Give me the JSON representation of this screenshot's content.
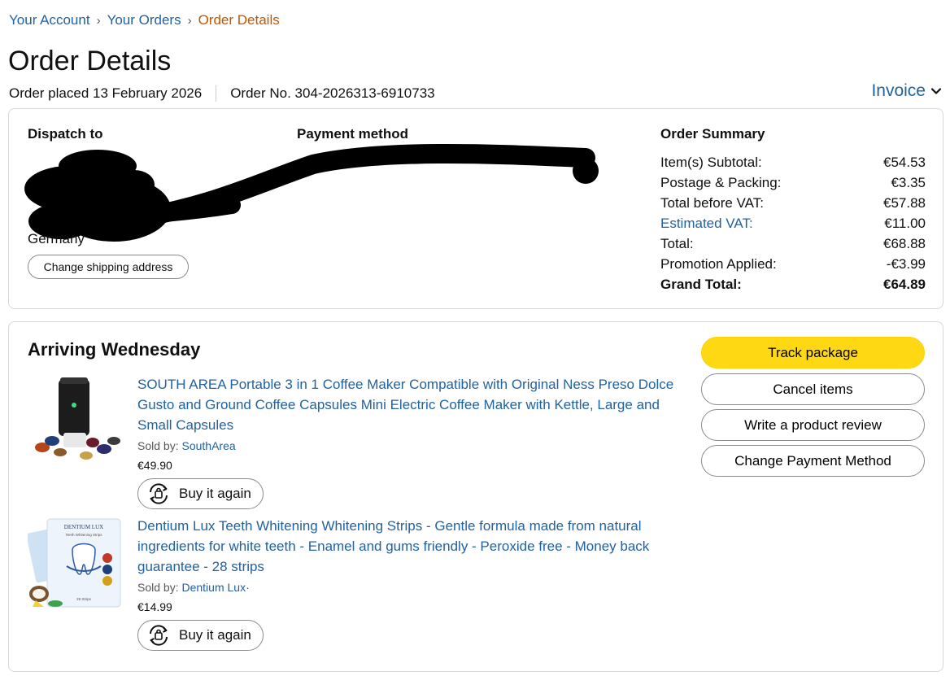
{
  "breadcrumb": {
    "items": [
      {
        "label": "Your Account"
      },
      {
        "label": "Your Orders"
      },
      {
        "label": "Order Details"
      }
    ],
    "separator": "›"
  },
  "header": {
    "title": "Order Details",
    "order_placed": "Order placed 13 February 2026",
    "order_number": "Order No. 304-2026313-6910733",
    "invoice_label": "Invoice"
  },
  "shipping": {
    "heading": "Dispatch to",
    "country": "Germany",
    "change_button": "Change shipping address"
  },
  "payment": {
    "heading": "Payment method"
  },
  "summary": {
    "heading": "Order Summary",
    "rows": [
      {
        "label": "Item(s) Subtotal:",
        "value": "€54.53"
      },
      {
        "label": "Postage & Packing:",
        "value": "€3.35"
      },
      {
        "label": "Total before VAT:",
        "value": "€57.88"
      },
      {
        "label": "Estimated VAT:",
        "value": "€11.00"
      },
      {
        "label": "Total:",
        "value": "€68.88"
      },
      {
        "label": "Promotion Applied:",
        "value": "-€3.99"
      },
      {
        "label": "Grand Total:",
        "value": "€64.89"
      }
    ]
  },
  "shipment": {
    "status": "Arriving Wednesday",
    "items": [
      {
        "title": "SOUTH AREA Portable 3 in 1 Coffee Maker Compatible with Original Ness Preso Dolce Gusto and Ground Coffee Capsules Mini Electric Coffee Maker with Kettle, Large and Small Capsules",
        "sold_by_label": "Sold by: ",
        "seller": "SouthArea",
        "price": "€49.90",
        "buy_again": "Buy it again"
      },
      {
        "title": "Dentium Lux Teeth Whitening Whitening Strips - Gentle formula made from natural ingredients for white teeth - Enamel and gums friendly - Peroxide free - Money back guarantee - 28 strips",
        "sold_by_label": "Sold by: ",
        "seller": "Dentium Lux·",
        "price": "€14.99",
        "buy_again": "Buy it again",
        "box_brand": "DENTIUM LUX",
        "box_subtitle": "Teeth Whitening Strips",
        "box_count": "28 Strips"
      }
    ],
    "actions": {
      "track": "Track package",
      "cancel": "Cancel items",
      "review": "Write a product review",
      "change_payment": "Change Payment Method"
    }
  },
  "colors": {
    "link": "#2162a1",
    "breadcrumb_current": "#c45500",
    "primary_button": "#ffd814",
    "border": "#d5d9d9",
    "redaction": "#000000"
  },
  "icons": {
    "invoice": "chevron-down-icon",
    "buy_again": "reorder-icon"
  }
}
